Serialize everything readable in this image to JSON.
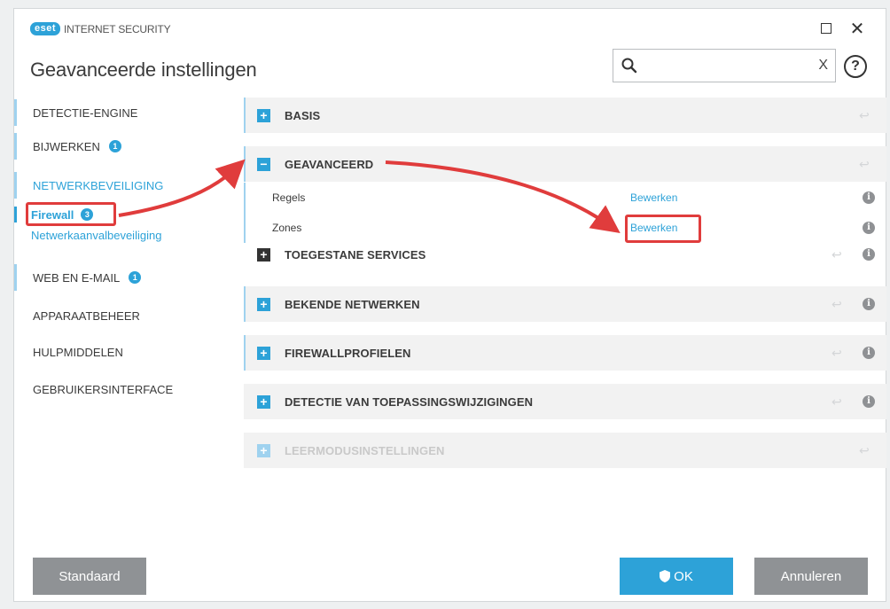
{
  "window": {
    "logo_badge": "eset",
    "product_name": "INTERNET SECURITY",
    "maximize_label": "",
    "close_label": "✕"
  },
  "header": {
    "title": "Geavanceerde instellingen",
    "search_value": "",
    "search_clear": "X",
    "help_label": "?"
  },
  "sidebar": {
    "items": [
      {
        "label": "DETECTIE-ENGINE"
      },
      {
        "label": "BIJWERKEN",
        "badge": "1"
      },
      {
        "label": "NETWERKBEVEILIGING"
      },
      {
        "label": "WEB EN E-MAIL",
        "badge": "1"
      },
      {
        "label": "APPARAATBEHEER"
      },
      {
        "label": "HULPMIDDELEN"
      },
      {
        "label": "GEBRUIKERSINTERFACE"
      }
    ],
    "sub_items": [
      {
        "label": "Firewall",
        "badge": "3"
      },
      {
        "label": "Netwerkaanvalbeveiliging"
      }
    ]
  },
  "sections": [
    {
      "toggle": "+",
      "title": "BASIS"
    },
    {
      "toggle": "−",
      "title": "GEAVANCEERD",
      "rows": [
        {
          "label": "Regels",
          "link": "Bewerken"
        },
        {
          "label": "Zones",
          "link": "Bewerken"
        }
      ]
    },
    {
      "toggle": "+",
      "title": "TOEGESTANE SERVICES"
    },
    {
      "toggle": "+",
      "title": "BEKENDE NETWERKEN"
    },
    {
      "toggle": "+",
      "title": "FIREWALLPROFIELEN"
    },
    {
      "toggle": "+",
      "title": "DETECTIE VAN TOEPASSINGSWIJZIGINGEN"
    },
    {
      "toggle": "+",
      "title": "LEERMODUSINSTELLINGEN"
    }
  ],
  "footer": {
    "default_label": "Standaard",
    "ok_label": "OK",
    "cancel_label": "Annuleren"
  },
  "colors": {
    "accent": "#2da2d8",
    "annotation": "#e03c3c",
    "button_gray": "#8f9295"
  }
}
